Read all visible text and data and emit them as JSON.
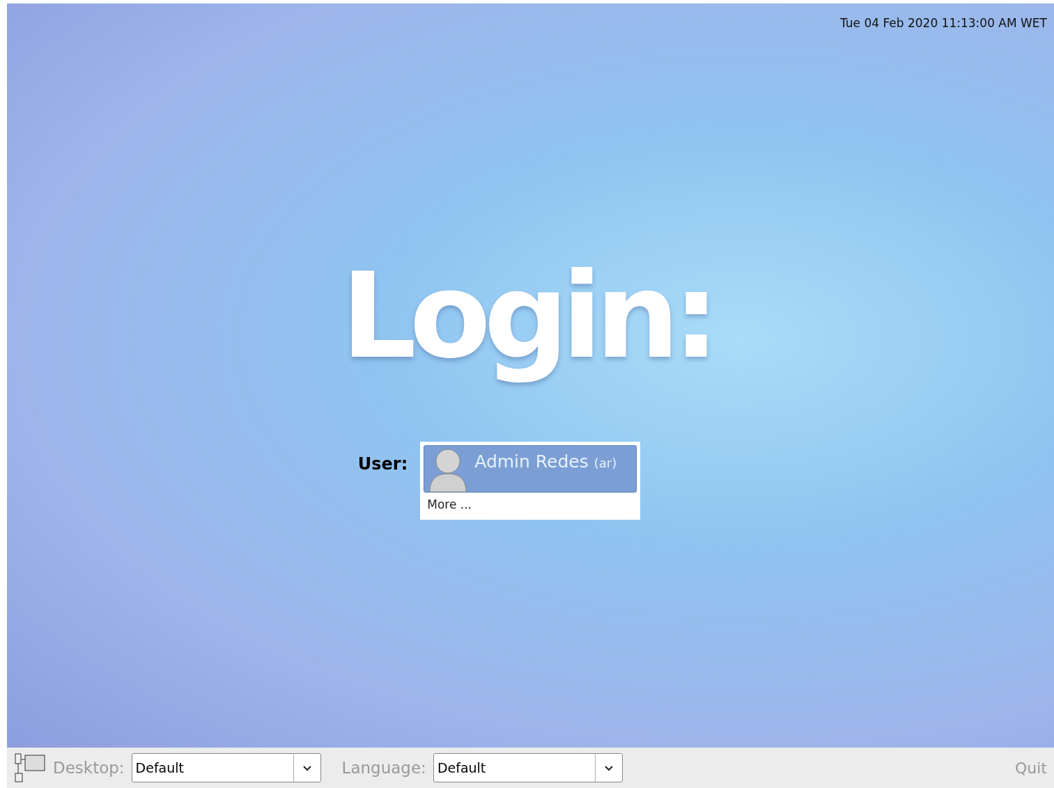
{
  "clock": "Tue 04 Feb 2020 11:13:00 AM WET",
  "title": "Login:",
  "user_label": "User:",
  "users": [
    {
      "kind": "account",
      "name": "Admin Redes",
      "login": "(ar)",
      "selected": true
    },
    {
      "kind": "more",
      "name": "More ...",
      "selected": false
    }
  ],
  "bottom_bar": {
    "desktop_label": "Desktop:",
    "desktop_value": "Default",
    "language_label": "Language:",
    "language_value": "Default",
    "quit": "Quit"
  }
}
